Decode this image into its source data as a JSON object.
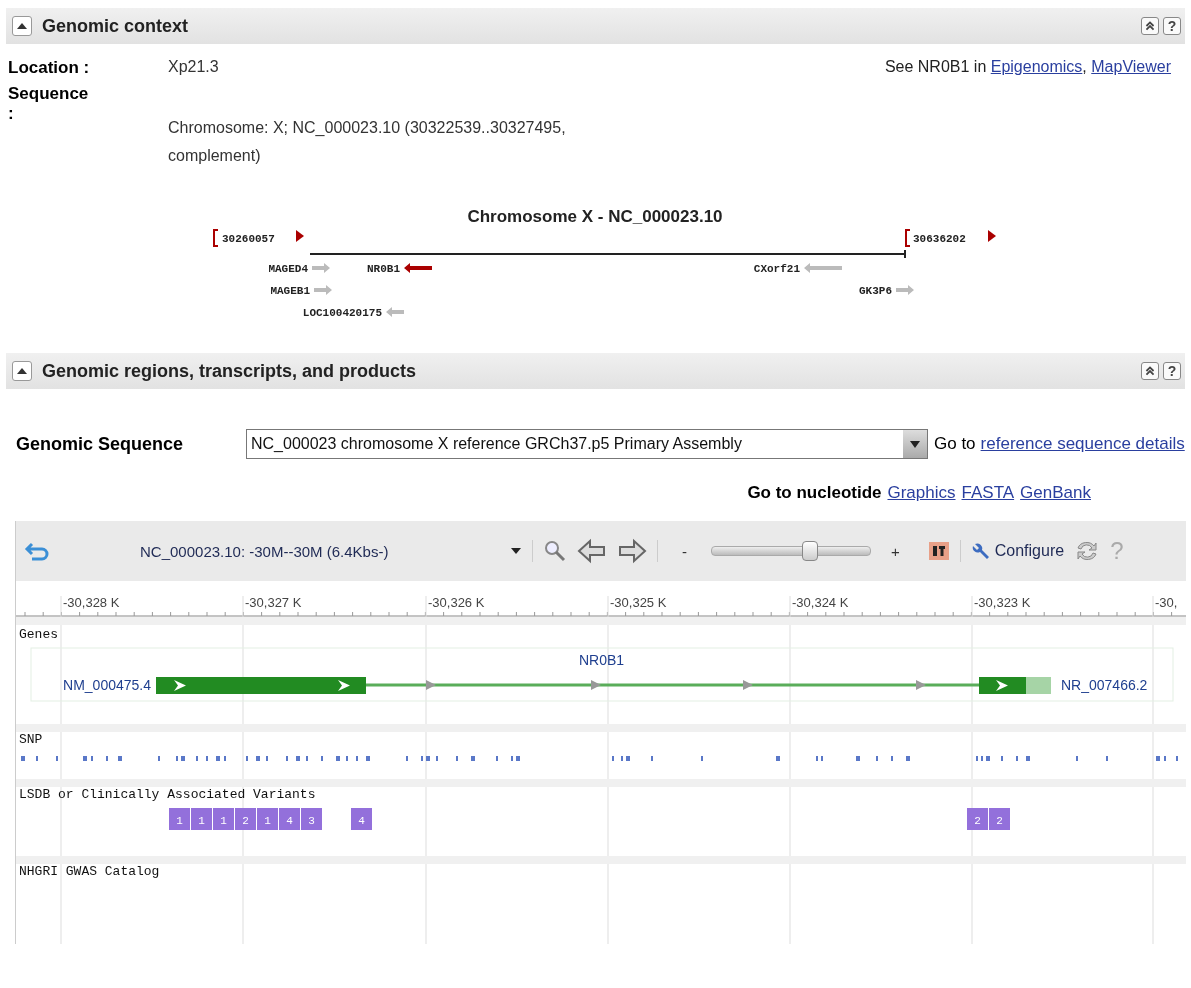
{
  "genomic_context": {
    "header": {
      "title": "Genomic context",
      "expanded": true,
      "help": "?"
    },
    "location": {
      "label": "Location :",
      "value": "Xp21.3"
    },
    "see_also": {
      "prefix": "See NR0B1 in",
      "links": [
        "Epigenomics",
        "MapViewer"
      ],
      "separator": ","
    },
    "sequence": {
      "label": "Sequence :",
      "lines": [
        "Chromosome: X; NC_000023.10 (30322539..30327495,",
        "complement)"
      ]
    },
    "map": {
      "title": "Chromosome X - NC_000023.10",
      "left_bound": "30260057",
      "right_bound": "30636202",
      "genes": [
        {
          "name": "MAGED4",
          "reverse": false,
          "selected": false
        },
        {
          "name": "NR0B1",
          "reverse": true,
          "selected": true
        },
        {
          "name": "CXorf21",
          "reverse": true,
          "selected": false
        },
        {
          "name": "MAGEB1",
          "reverse": false,
          "selected": false
        },
        {
          "name": "GK3P6",
          "reverse": false,
          "selected": false
        },
        {
          "name": "LOC100420175",
          "reverse": true,
          "selected": false
        }
      ]
    }
  },
  "regions": {
    "header": {
      "title": "Genomic regions, transcripts, and products",
      "expanded": true,
      "help": "?"
    },
    "genomic_sequence": {
      "label": "Genomic Sequence",
      "value": "NC_000023 chromosome X reference GRCh37.p5 Primary Assembly",
      "go_label": "Go to",
      "link": "reference sequence details"
    },
    "nucleotide": {
      "label": "Go to nucleotide",
      "links": [
        "Graphics",
        "FASTA",
        "GenBank"
      ]
    },
    "viewer": {
      "title": "NC_000023.10: -30M--30M (6.4Kbs-)",
      "zoom_out": "-",
      "zoom_in": "+",
      "zoom": {
        "level": 0.62
      },
      "configure": "Configure",
      "help": "?",
      "ruler": [
        "-30,328 K",
        "-30,327 K",
        "-30,326 K",
        "-30,325 K",
        "-30,324 K",
        "-30,323 K",
        "-30,"
      ],
      "tracks": [
        {
          "kind": "genes",
          "name": "Genes",
          "gene": "NR0B1",
          "transcripts": [
            "NM_000475.4",
            "NR_007466.2"
          ]
        },
        {
          "kind": "snp",
          "name": "SNP"
        },
        {
          "kind": "variants",
          "name": "LSDB or Clinically Associated Variants",
          "variants": [
            "1",
            "1",
            "1",
            "2",
            "1",
            "4",
            "3",
            "4",
            "2",
            "2"
          ]
        },
        {
          "kind": "gwas",
          "name": "NHGRI GWAS Catalog"
        }
      ]
    }
  }
}
